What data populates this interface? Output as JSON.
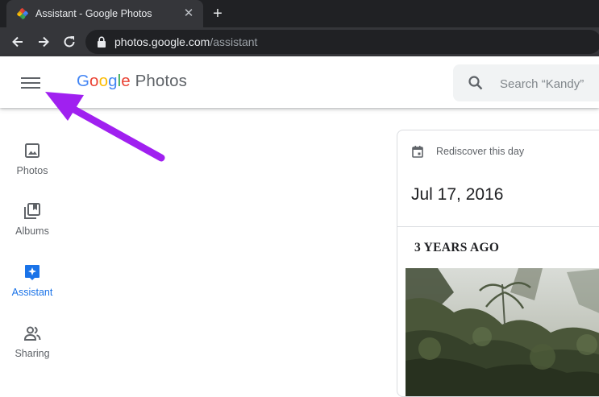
{
  "browser": {
    "tab_title": "Assistant - Google Photos",
    "tab_close": "✕",
    "new_tab": "+",
    "url_host": "photos.google.com",
    "url_path": "/assistant"
  },
  "header": {
    "logo_letters": [
      "G",
      "o",
      "o",
      "g",
      "l",
      "e"
    ],
    "logo_product": "Photos",
    "search_placeholder": "Search “Kandy”"
  },
  "sidebar": {
    "items": [
      {
        "label": "Photos",
        "active": false
      },
      {
        "label": "Albums",
        "active": false
      },
      {
        "label": "Assistant",
        "active": true
      },
      {
        "label": "Sharing",
        "active": false
      }
    ]
  },
  "card": {
    "kicker": "Rediscover this day",
    "date": "Jul 17, 2016",
    "section": "3 YEARS AGO"
  },
  "colors": {
    "chrome_dark": "#202124",
    "chrome_tab": "#35363a",
    "accent_blue": "#1a73e8",
    "annotation_arrow": "#a020f0"
  }
}
